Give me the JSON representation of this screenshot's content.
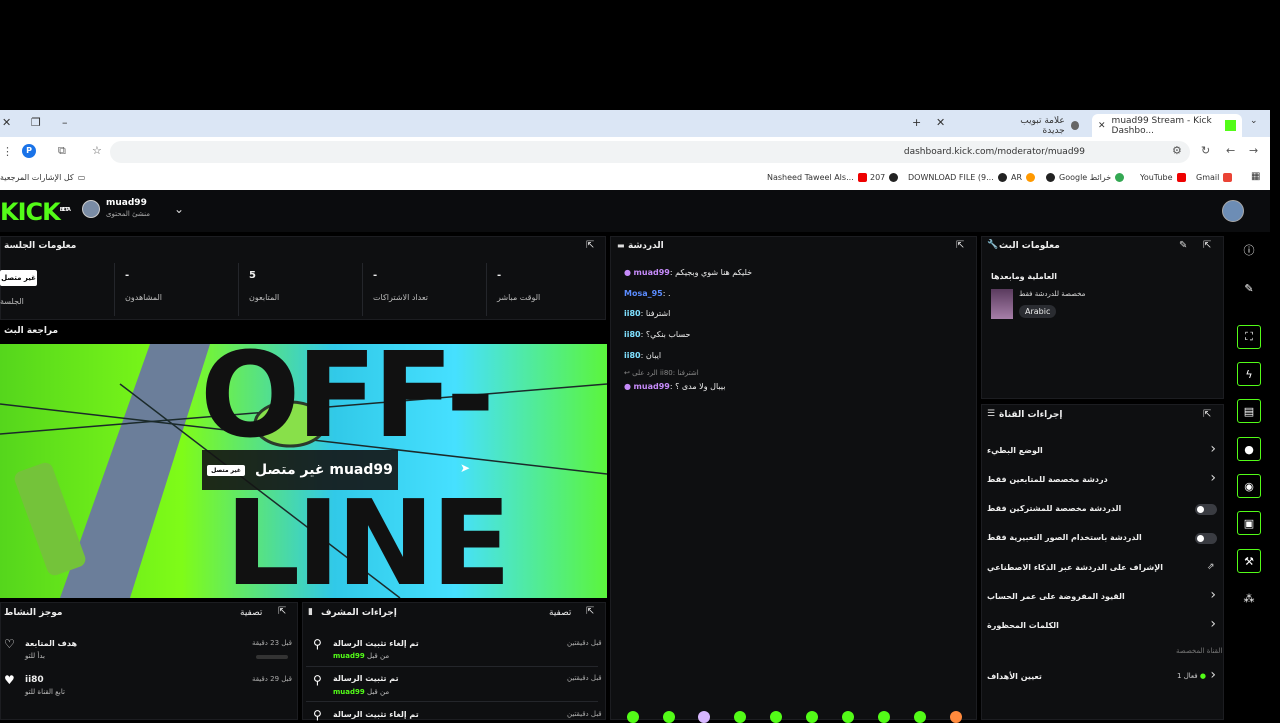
{
  "browser": {
    "tabs": [
      {
        "title": "muad99 Stream - Kick Dashbo..."
      },
      {
        "title": "علامة تبويب جديدة"
      }
    ],
    "url": "dashboard.kick.com/moderator/muad99",
    "profile_initial": "P",
    "bookmarks_folder": "كل الإشارات المرجعية",
    "bookmarks": [
      "Nasheed Taweel Als...",
      "207",
      "DOWNLOAD FILE (9...",
      "AR",
      "Google خرائط",
      "YouTube",
      "Gmail"
    ]
  },
  "topnav": {
    "logo": "KICK",
    "beta": "BETA",
    "username": "muad99",
    "role": "منشئ المحتوى"
  },
  "session": {
    "title": "معلومات الجلسة",
    "offline_badge": "غير متصل",
    "session_label": "الجلسة",
    "stats": [
      {
        "value": "-",
        "label": "المشاهدون"
      },
      {
        "value": "5",
        "label": "المتابعون"
      },
      {
        "value": "-",
        "label": "تعداد الاشتراكات"
      },
      {
        "value": "-",
        "label": "الوقت مباشر"
      }
    ]
  },
  "preview": {
    "title": "مراجعة البث",
    "overlay_name": "muad99 غير متصل",
    "overlay_badge": "غير متصل",
    "bg_text_1": "OFF-",
    "bg_text_2": "LINE"
  },
  "chat": {
    "title": "الدردشة",
    "messages": [
      {
        "user": "muad99",
        "text": "خليكم هنا شوي وبجيكم",
        "color": "#c58af9"
      },
      {
        "user": "Mosa_95",
        "text": ".",
        "color": "#5b8cff"
      },
      {
        "user": "ii80",
        "text": "اشترفنا",
        "color": "#7fe0ff"
      },
      {
        "user": "ii80",
        "text": "حساب بنكي؟",
        "color": "#7fe0ff"
      },
      {
        "user": "ii80",
        "text": "ايبان",
        "color": "#7fe0ff"
      },
      {
        "user": "muad99",
        "text": "بيبال ولا مدى ؟",
        "color": "#c58af9"
      }
    ],
    "reply_to": "الرد على ii80: اشترفنا"
  },
  "stream_info": {
    "title": "معلومات البث",
    "stream_title": "العاملية ومابعدها",
    "category": "مخصصة للدردشة فقط",
    "language": "Arabic"
  },
  "channel_actions": {
    "title": "إجراءات القناة",
    "items": [
      {
        "label": "الوضع البطيء",
        "control": "chevron"
      },
      {
        "label": "دردشة مخصصة للمتابعين فقط",
        "control": "chevron"
      },
      {
        "label": "الدردشة مخصصة للمشتركين فقط",
        "control": "toggle"
      },
      {
        "label": "الدردشة باستخدام الصور التعبيرية فقط",
        "control": "toggle"
      },
      {
        "label": "الإشراف على الدردشة عبر الذكاء الاصطناعي",
        "control": "external"
      },
      {
        "label": "القيود المفروضة على عمر الحساب",
        "control": "chevron"
      },
      {
        "label": "الكلمات المحظورة",
        "control": "chevron"
      }
    ],
    "section_label": "القناة المخصصة",
    "goals_label": "تعيين الأهداف",
    "goals_status": "فعال 1"
  },
  "activity": {
    "title": "موجز النشاط",
    "filter": "تصفية",
    "items": [
      {
        "title": "هدف المتابعة",
        "sub": "بدأ للتو",
        "time": "قبل 23 دقيقة"
      },
      {
        "title": "ii80",
        "sub": "تابع القناة للتو",
        "time": "قبل 29 دقيقة"
      }
    ]
  },
  "mod_actions": {
    "title": "إجراءات المشرف",
    "filter": "تصفية",
    "by_label": "من قبل",
    "items": [
      {
        "title": "تم إلغاء تثبيت الرسالة",
        "by": "muad99",
        "time": "قبل دقيقتين"
      },
      {
        "title": "تم تثبيت الرسالة",
        "by": "muad99",
        "time": "قبل دقيقتين"
      },
      {
        "title": "تم إلغاء تثبيت الرسالة",
        "by": "",
        "time": "قبل دقيقتين"
      }
    ]
  }
}
